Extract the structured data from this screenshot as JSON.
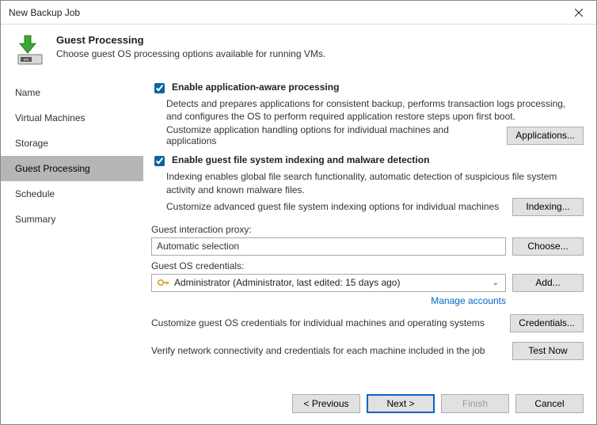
{
  "window": {
    "title": "New Backup Job"
  },
  "header": {
    "title": "Guest Processing",
    "description": "Choose guest OS processing options available for running VMs."
  },
  "sidebar": {
    "items": [
      {
        "label": "Name"
      },
      {
        "label": "Virtual Machines"
      },
      {
        "label": "Storage"
      },
      {
        "label": "Guest Processing"
      },
      {
        "label": "Schedule"
      },
      {
        "label": "Summary"
      }
    ]
  },
  "options": {
    "appAware": {
      "label": "Enable application-aware processing",
      "desc": "Detects and prepares applications for consistent backup, performs transaction logs processing, and configures the OS to perform required application restore steps upon first boot.",
      "customizeText": "Customize application handling options for individual machines and applications",
      "button": "Applications..."
    },
    "indexing": {
      "label": "Enable guest file system indexing and malware detection",
      "desc": "Indexing enables global file search functionality, automatic detection of suspicious file system activity and known malware files.",
      "customizeText": "Customize advanced guest file system indexing options for individual machines",
      "button": "Indexing..."
    },
    "proxy": {
      "label": "Guest interaction proxy:",
      "value": "Automatic selection",
      "button": "Choose..."
    },
    "credentials": {
      "label": "Guest OS credentials:",
      "value": "Administrator (Administrator, last edited: 15 days ago)",
      "addButton": "Add...",
      "manageLink": "Manage accounts",
      "customizeText": "Customize guest OS credentials for individual machines and operating systems",
      "credButton": "Credentials..."
    },
    "verify": {
      "text": "Verify network connectivity and credentials for each machine included in the job",
      "button": "Test Now"
    }
  },
  "footer": {
    "previous": "< Previous",
    "next": "Next >",
    "finish": "Finish",
    "cancel": "Cancel"
  }
}
